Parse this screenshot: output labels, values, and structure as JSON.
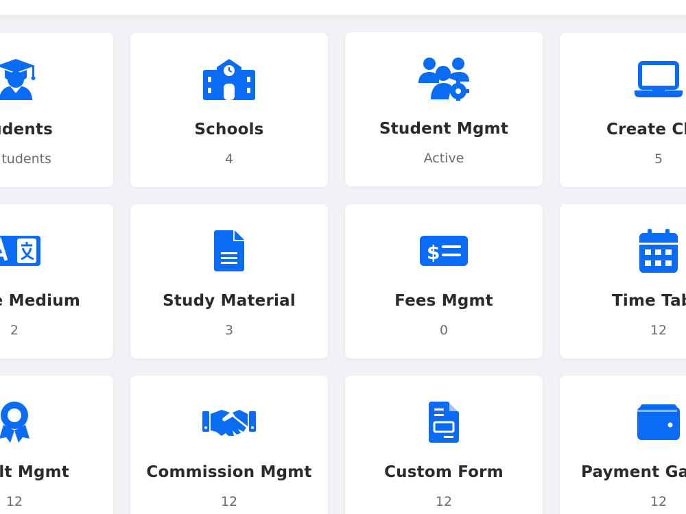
{
  "theme": {
    "accent": "#0a6cf5",
    "background": "#f1f2f6",
    "card": "#ffffff",
    "title_color": "#2b2b2b",
    "sub_color": "#6b6b6b"
  },
  "cards": [
    {
      "title": "udents",
      "sub": "tudents",
      "icon": "graduate-icon"
    },
    {
      "title": "Schools",
      "sub": "4",
      "icon": "school-building-icon"
    },
    {
      "title": "Student Mgmt",
      "sub": "Active",
      "icon": "users-gear-icon"
    },
    {
      "title": "Create Cla",
      "sub": "5",
      "icon": "laptop-icon"
    },
    {
      "title": "e Medium",
      "sub": "2",
      "icon": "language-icon"
    },
    {
      "title": "Study Material",
      "sub": "3",
      "icon": "document-icon"
    },
    {
      "title": "Fees Mgmt",
      "sub": "0",
      "icon": "money-check-icon"
    },
    {
      "title": "Time Tab",
      "sub": "12",
      "icon": "calendar-icon"
    },
    {
      "title": "lt Mgmt",
      "sub": "12",
      "icon": "award-icon"
    },
    {
      "title": "Commission Mgmt",
      "sub": "12",
      "icon": "handshake-icon"
    },
    {
      "title": "Custom Form",
      "sub": "12",
      "icon": "form-document-icon"
    },
    {
      "title": "Payment Ga",
      "sub": "12",
      "icon": "wallet-icon"
    }
  ]
}
